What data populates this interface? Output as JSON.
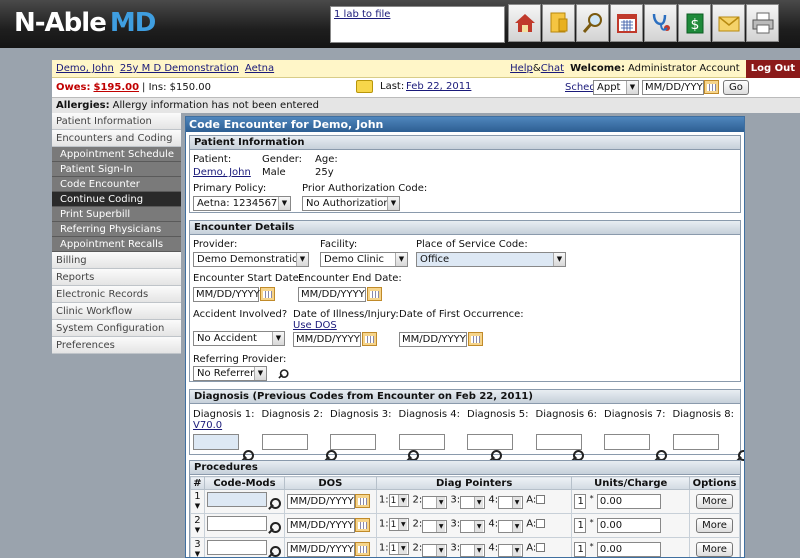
{
  "header": {
    "logo_left": "N-Able",
    "logo_right": "MD",
    "notice_link": "1 lab to file",
    "toolbar_icons": [
      "home-icon",
      "document-icon",
      "search-icon",
      "calendar-icon",
      "stethoscope-icon",
      "billing-dollar-icon",
      "mail-icon",
      "print-icon"
    ]
  },
  "infobar": {
    "patient_name": "Demo, John",
    "patient_desc": "25y M D Demonstration",
    "insurer": "Aetna",
    "help": "Help",
    "amp": "&",
    "chat": "Chat",
    "welcome_label": "Welcome:",
    "welcome_user": "Administrator Account",
    "logout": "Log Out"
  },
  "owesbar": {
    "owes_label": "Owes:",
    "owes_amount": "$195.00",
    "ins": "| Ins: $150.00",
    "last_label": "Last:",
    "last_date": "Feb 22, 2011",
    "sched": "Sched",
    "sched_type": "Appt",
    "date_placeholder": "MM/DD/YYY",
    "go": "Go"
  },
  "allergy": {
    "label": "Allergies:",
    "text": "Allergy information has not been entered"
  },
  "sidebar": {
    "items": [
      {
        "label": "Patient Information",
        "type": "main"
      },
      {
        "label": "Encounters and Coding",
        "type": "main"
      },
      {
        "label": "Appointment Schedule",
        "type": "sub"
      },
      {
        "label": "Patient Sign-In",
        "type": "sub"
      },
      {
        "label": "Code Encounter",
        "type": "sub"
      },
      {
        "label": "Continue Coding",
        "type": "sub",
        "active": true
      },
      {
        "label": "Print Superbill",
        "type": "sub"
      },
      {
        "label": "Referring Physicians",
        "type": "sub"
      },
      {
        "label": "Appointment Recalls",
        "type": "sub"
      },
      {
        "label": "Billing",
        "type": "main"
      },
      {
        "label": "Reports",
        "type": "main"
      },
      {
        "label": "Electronic Records",
        "type": "main"
      },
      {
        "label": "Clinic Workflow",
        "type": "main"
      },
      {
        "label": "System Configuration",
        "type": "main"
      },
      {
        "label": "Preferences",
        "type": "main"
      }
    ]
  },
  "main": {
    "title": "Code Encounter for Demo, John",
    "patient_info": {
      "heading": "Patient Information",
      "patient_label": "Patient:",
      "patient_value": "Demo, John",
      "gender_label": "Gender:",
      "gender_value": "Male",
      "age_label": "Age:",
      "age_value": "25y",
      "policy_label": "Primary Policy:",
      "policy_value": "Aetna: 1234567",
      "prior_auth_label": "Prior Authorization Code:",
      "prior_auth_value": "No Authorization"
    },
    "encounter": {
      "heading": "Encounter Details",
      "provider_label": "Provider:",
      "provider_value": "Demo Demonstration",
      "facility_label": "Facility:",
      "facility_value": "Demo Clinic",
      "pos_label": "Place of Service Code:",
      "pos_value": "Office",
      "start_label": "Encounter Start Date:",
      "end_label": "Encounter End Date:",
      "date_placeholder": "MM/DD/YYYY",
      "accident_label": "Accident Involved?",
      "accident_value": "No Accident",
      "illness_label": "Date of Illness/Injury:",
      "use_dos": "Use DOS",
      "first_occ_label": "Date of First Occurrence:",
      "referring_label": "Referring Provider:",
      "referring_value": "No Referrer"
    },
    "diagnosis": {
      "heading": "Diagnosis (Previous Codes from Encounter on Feb 22, 2011)",
      "labels": [
        "Diagnosis 1:",
        "Diagnosis 2:",
        "Diagnosis 3:",
        "Diagnosis 4:",
        "Diagnosis 5:",
        "Diagnosis 6:",
        "Diagnosis 7:",
        "Diagnosis 8:"
      ],
      "diag1_code": "V70.0"
    },
    "procedures": {
      "heading": "Procedures",
      "columns": [
        "#",
        "Code-Mods",
        "DOS",
        "Diag Pointers",
        "Units/Charge",
        "Options"
      ],
      "rows": [
        {
          "num": "1",
          "dos": "MM/DD/YYYY",
          "p1": "1",
          "units": "1",
          "charge": "0.00",
          "more": "More"
        },
        {
          "num": "2",
          "dos": "MM/DD/YYYY",
          "p1": "1",
          "units": "1",
          "charge": "0.00",
          "more": "More"
        },
        {
          "num": "3",
          "dos": "MM/DD/YYYY",
          "p1": "1",
          "units": "1",
          "charge": "0.00",
          "more": "More"
        }
      ],
      "pointer_labels": [
        "1:",
        "2:",
        "3:",
        "4:",
        "A:"
      ]
    }
  }
}
